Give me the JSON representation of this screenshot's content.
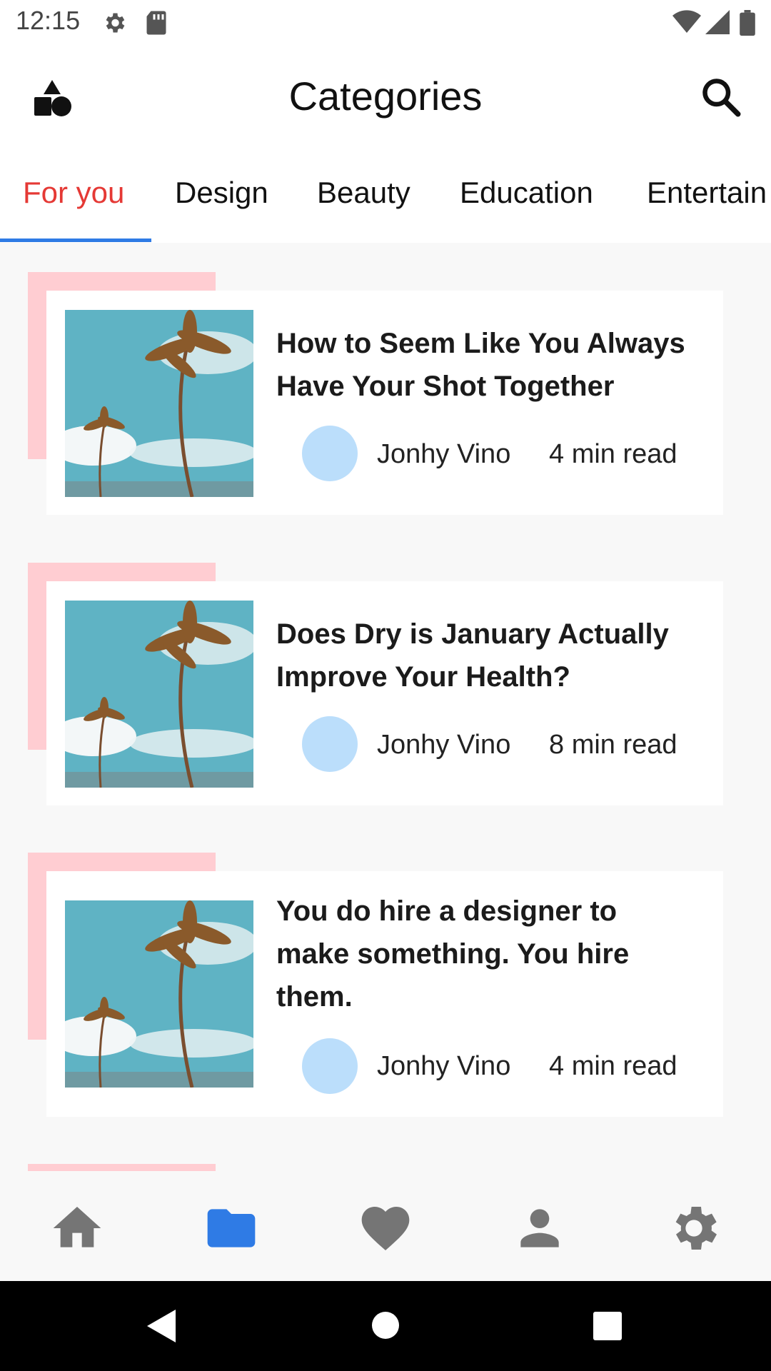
{
  "status_bar": {
    "time": "12:15",
    "icons": [
      "gear-icon",
      "sd-card-icon",
      "wifi-icon",
      "signal-icon",
      "battery-icon"
    ]
  },
  "app_bar": {
    "title": "Categories",
    "logo_icon": "shapes-icon",
    "search_icon": "search-icon"
  },
  "tabs": [
    {
      "label": "For you",
      "active": true
    },
    {
      "label": "Design",
      "active": false
    },
    {
      "label": "Beauty",
      "active": false
    },
    {
      "label": "Education",
      "active": false
    },
    {
      "label": "Entertain",
      "active": false
    }
  ],
  "articles": [
    {
      "title_lines": [
        "How to Seem Like You Always",
        "Have Your Shot Together"
      ],
      "author": "Jonhy Vino",
      "read_time": "4 min read"
    },
    {
      "title_lines": [
        "Does Dry is January Actually",
        "Improve Your Health?"
      ],
      "author": "Jonhy Vino",
      "read_time": "8 min read"
    },
    {
      "title_lines": [
        "You do hire a designer to",
        "make something. You hire",
        "them."
      ],
      "author": "Jonhy Vino",
      "read_time": "4 min read"
    }
  ],
  "bottom_nav": [
    {
      "icon": "home-icon",
      "active": false
    },
    {
      "icon": "folder-icon",
      "active": true
    },
    {
      "icon": "heart-icon",
      "active": false
    },
    {
      "icon": "person-icon",
      "active": false
    },
    {
      "icon": "settings-icon",
      "active": false
    }
  ],
  "colors": {
    "active_tab": "#e53935",
    "indicator": "#2f7be5",
    "accent_block": "#ffcdd2",
    "avatar": "#bbdefb",
    "nav_active": "#2f7be5",
    "nav_inactive": "#757575"
  }
}
